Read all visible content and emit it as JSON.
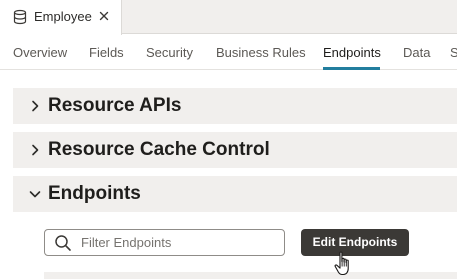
{
  "document_tab": {
    "title": "Employee",
    "icon": "database-icon",
    "close_icon": "close-icon"
  },
  "nav": {
    "tabs": [
      {
        "label": "Overview",
        "active": false
      },
      {
        "label": "Fields",
        "active": false
      },
      {
        "label": "Security",
        "active": false
      },
      {
        "label": "Business Rules",
        "active": false
      },
      {
        "label": "Endpoints",
        "active": true
      },
      {
        "label": "Data",
        "active": false
      },
      {
        "label": "S",
        "active": false
      }
    ],
    "accent_color": "#227e9e"
  },
  "sections": [
    {
      "title": "Resource APIs",
      "expanded": false
    },
    {
      "title": "Resource Cache Control",
      "expanded": false
    },
    {
      "title": "Endpoints",
      "expanded": true
    }
  ],
  "endpoints": {
    "search_placeholder": "Filter Endpoints",
    "search_value": "",
    "edit_button_label": "Edit Endpoints"
  },
  "colors": {
    "section_bg": "#f1efed",
    "button_bg": "#3b3936"
  }
}
